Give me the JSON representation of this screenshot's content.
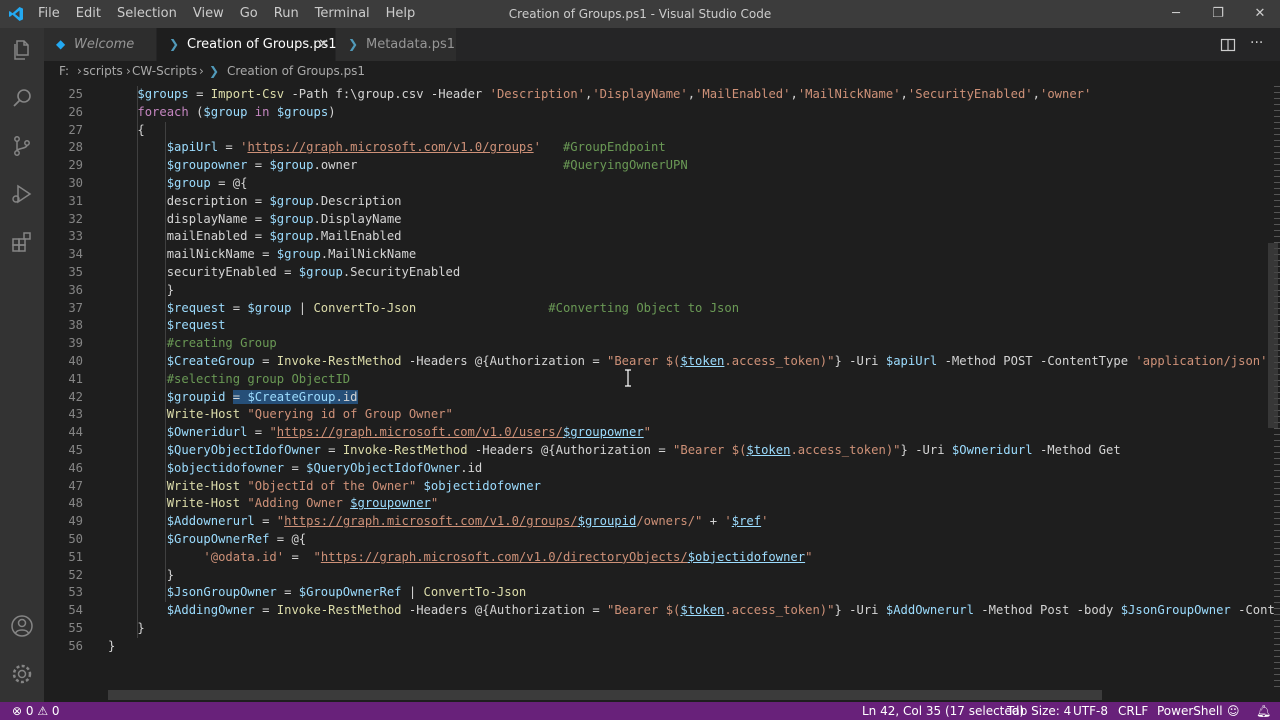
{
  "window": {
    "title": "Creation of Groups.ps1 - Visual Studio Code",
    "minimize": "─",
    "maximize": "❐",
    "close": "✕"
  },
  "menu": [
    "File",
    "Edit",
    "Selection",
    "View",
    "Go",
    "Run",
    "Terminal",
    "Help"
  ],
  "tabs": [
    {
      "label": "Welcome",
      "icon": "vscode-logo-icon"
    },
    {
      "label": "Creation of Groups.ps1",
      "icon": "powershell-icon",
      "close": "✕"
    },
    {
      "label": "Metadata.ps1",
      "icon": "powershell-icon"
    }
  ],
  "breadcrumb": {
    "drive": "F:",
    "sep": "›",
    "folder1": "scripts",
    "folder2": "CW-Scripts",
    "file": "Creation of Groups.ps1"
  },
  "colors": {
    "statusbar": "#68217a",
    "editor_bg": "#1e1e1e",
    "activity_bg": "#333333"
  },
  "editor": {
    "lines": [
      {
        "n": "25",
        "t": "    $groups = Import-Csv -Path f:\\group.csv -Header 'Description','DisplayName','MailEnabled','MailNickName','SecurityEnabled','owner'"
      },
      {
        "n": "26",
        "t": "    foreach ($group in $groups)"
      },
      {
        "n": "27",
        "t": "    {"
      },
      {
        "n": "28",
        "t": "        $apiUrl = 'https://graph.microsoft.com/v1.0/groups'   #GroupEndpoint"
      },
      {
        "n": "29",
        "t": "        $groupowner = $group.owner                            #QueryingOwnerUPN"
      },
      {
        "n": "30",
        "t": "        $group = @{"
      },
      {
        "n": "31",
        "t": "        description = $group.Description"
      },
      {
        "n": "32",
        "t": "        displayName = $group.DisplayName"
      },
      {
        "n": "33",
        "t": "        mailEnabled = $group.MailEnabled"
      },
      {
        "n": "34",
        "t": "        mailNickName = $group.MailNickName"
      },
      {
        "n": "35",
        "t": "        securityEnabled = $group.SecurityEnabled"
      },
      {
        "n": "36",
        "t": "        }"
      },
      {
        "n": "37",
        "t": "        $request = $group | ConvertTo-Json                  #Converting Object to Json"
      },
      {
        "n": "38",
        "t": "        $request"
      },
      {
        "n": "39",
        "t": "        #creating Group"
      },
      {
        "n": "40",
        "t": "        $CreateGroup = Invoke-RestMethod -Headers @{Authorization = \"Bearer $($token.access_token)\"} -Uri $apiUrl -Method POST -ContentType 'application/json' -bo"
      },
      {
        "n": "41",
        "t": "        #selecting group ObjectID"
      },
      {
        "n": "42",
        "t": "        $groupid = $CreateGroup.id"
      },
      {
        "n": "43",
        "t": "        Write-Host \"Querying id of Group Owner\""
      },
      {
        "n": "44",
        "t": "        $Owneridurl = \"https://graph.microsoft.com/v1.0/users/$groupowner\""
      },
      {
        "n": "45",
        "t": "        $QueryObjectIdofOwner = Invoke-RestMethod -Headers @{Authorization = \"Bearer $($token.access_token)\"} -Uri $Owneridurl -Method Get"
      },
      {
        "n": "46",
        "t": "        $objectidofowner = $QueryObjectIdofOwner.id"
      },
      {
        "n": "47",
        "t": "        Write-Host \"ObjectId of the Owner\" $objectidofowner"
      },
      {
        "n": "48",
        "t": "        Write-Host \"Adding Owner $groupowner\""
      },
      {
        "n": "49",
        "t": "        $Addownerurl = \"https://graph.microsoft.com/v1.0/groups/$groupid/owners/\" + '$ref'"
      },
      {
        "n": "50",
        "t": "        $GroupOwnerRef = @{"
      },
      {
        "n": "51",
        "t": "             '@odata.id' =  \"https://graph.microsoft.com/v1.0/directoryObjects/$objectidofowner\""
      },
      {
        "n": "52",
        "t": "        }"
      },
      {
        "n": "53",
        "t": "        $JsonGroupOwner = $GroupOwnerRef | ConvertTo-Json"
      },
      {
        "n": "54",
        "t": "        $AddingOwner = Invoke-RestMethod -Headers @{Authorization = \"Bearer $($token.access_token)\"} -Uri $AddOwnerurl -Method Post -body $JsonGroupOwner -Content"
      },
      {
        "n": "55",
        "t": "    }"
      },
      {
        "n": "56",
        "t": "}"
      }
    ]
  },
  "status": {
    "errors": "0",
    "warnings": "0",
    "position": "Ln 42, Col 35 (17 selected)",
    "tab_size": "Tab Size: 4",
    "encoding": "UTF-8",
    "eol": "CRLF",
    "language": "PowerShell"
  }
}
